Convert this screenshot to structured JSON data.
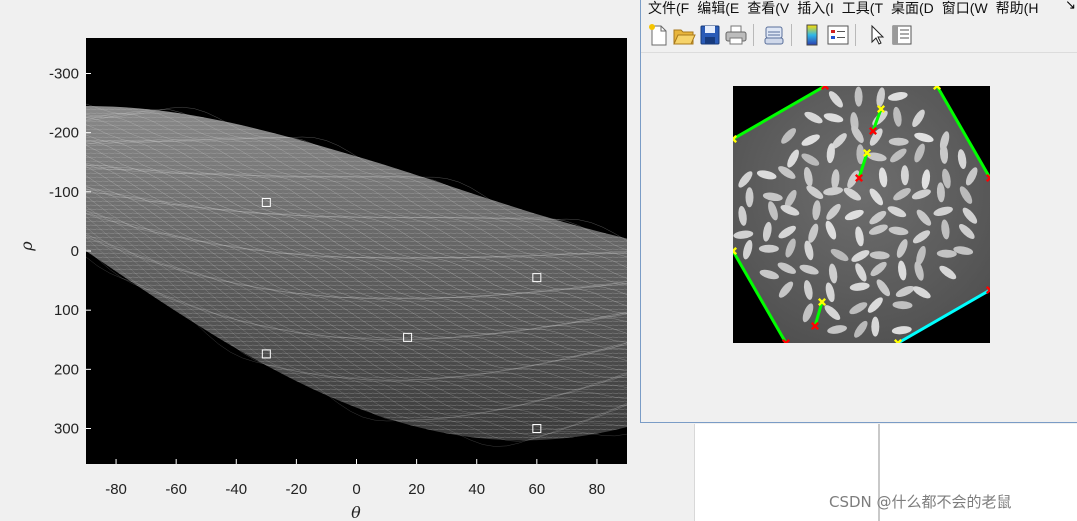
{
  "left_figure": {
    "x_ticks": [
      "-80",
      "-60",
      "-40",
      "-20",
      "0",
      "20",
      "40",
      "60",
      "80"
    ],
    "y_ticks": [
      "-300",
      "-200",
      "-100",
      "0",
      "100",
      "200",
      "300"
    ],
    "x_label": "θ",
    "y_label": "ρ",
    "peaks": [
      {
        "theta": -30,
        "rho": -82
      },
      {
        "theta": -30,
        "rho": 174
      },
      {
        "theta": 17,
        "rho": 146
      },
      {
        "theta": 60,
        "rho": 45
      },
      {
        "theta": 60,
        "rho": 300
      }
    ],
    "peak_color": "#ffffff"
  },
  "right_window": {
    "menu": [
      "文件(F",
      "编辑(E",
      "查看(V",
      "插入(I",
      "工具(T",
      "桌面(D",
      "窗口(W",
      "帮助(H"
    ],
    "toolbar": [
      "new-figure-icon",
      "open-file-icon",
      "save-icon",
      "print-icon",
      "link-icon",
      "colorbar-icon",
      "legend-icon",
      "pointer-icon",
      "property-inspector-icon"
    ]
  },
  "detected_lines": {
    "start_marker_color": "#ffff00",
    "end_marker_color": "#ff0000",
    "line_color": "#00ff00",
    "longest_line_color": "#00ffff"
  },
  "watermark": "CSDN @什么都不会的老鼠"
}
